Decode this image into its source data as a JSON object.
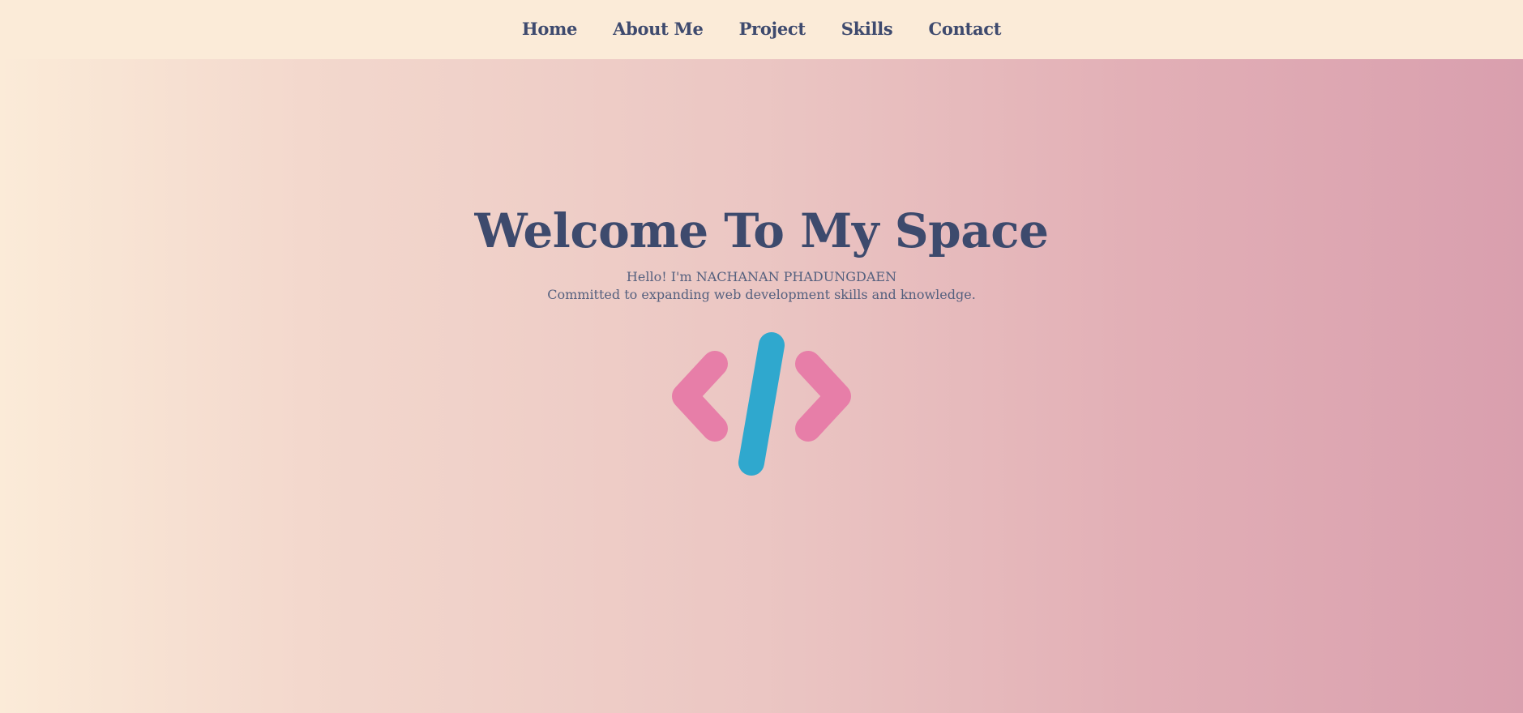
{
  "nav": {
    "items": [
      {
        "label": "Home"
      },
      {
        "label": "About Me"
      },
      {
        "label": "Project"
      },
      {
        "label": "Skills"
      },
      {
        "label": "Contact"
      }
    ]
  },
  "hero": {
    "title": "Welcome To My Space",
    "greeting": "Hello! I'm NACHANAN PHADUNGDAEN",
    "tagline": "Committed to expanding web development skills and knowledge.",
    "logo_icon": "code-brackets-icon",
    "colors": {
      "brackets": "#e77ea8",
      "slash": "#2fa8ce",
      "text": "#3d4a6d"
    }
  }
}
